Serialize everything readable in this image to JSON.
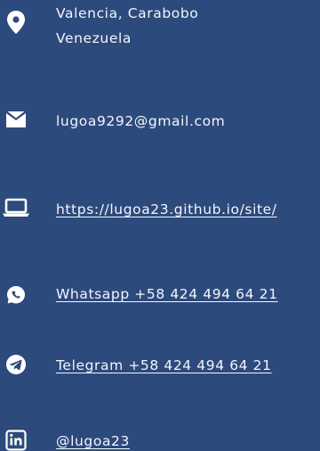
{
  "contacts": {
    "location": {
      "icon": "location-pin-icon",
      "line1": "Valencia, Carabobo",
      "line2": "Venezuela"
    },
    "email": {
      "icon": "envelope-icon",
      "value": "lugoa9292@gmail.com"
    },
    "website": {
      "icon": "laptop-icon",
      "value": "https://lugoa23.github.io/site/"
    },
    "whatsapp": {
      "icon": "whatsapp-icon",
      "value": "Whatsapp   +58 424 494 64 21 "
    },
    "telegram": {
      "icon": "telegram-icon",
      "value": "Telegram   +58 424 494 64 21 "
    },
    "linkedin": {
      "icon": "linkedin-icon",
      "value": "@lugoa23"
    }
  },
  "colors": {
    "background": "#2c4a7c",
    "text": "#f4f6fa"
  }
}
